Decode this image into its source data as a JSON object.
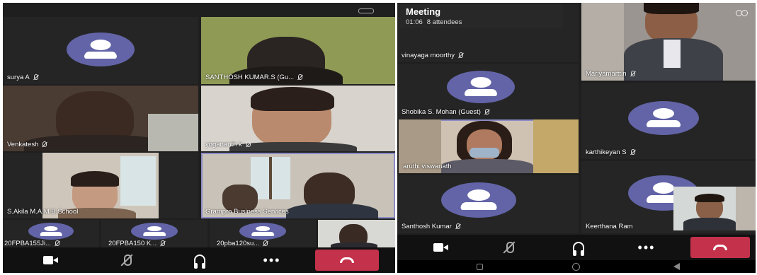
{
  "left_call": {
    "participants": [
      {
        "name": "surya A",
        "muted": true,
        "video": false
      },
      {
        "name": "SANTHOSH KUMAR.S (Gu...",
        "muted": true,
        "video": true
      },
      {
        "name": "Venkatesh",
        "muted": true,
        "video": true
      },
      {
        "name": "yogananth k",
        "muted": true,
        "video": true
      },
      {
        "name": "S.Akila M.A.M.B.School",
        "muted": false,
        "video": true
      },
      {
        "name": "Grampro Business Services",
        "muted": false,
        "video": true
      },
      {
        "name": "20FPBA155Ji...",
        "muted": true,
        "video": false
      },
      {
        "name": "20FPBA150 K...",
        "muted": true,
        "video": false
      },
      {
        "name": "20pba120su...",
        "muted": true,
        "video": false
      }
    ]
  },
  "right_call": {
    "meeting_title": "Meeting",
    "duration": "01:06",
    "attendees": "8 attendees",
    "participants": [
      {
        "name": "vinayaga moorthy",
        "muted": true,
        "video": false
      },
      {
        "name": "Mariyamarttin",
        "muted": true,
        "video": true
      },
      {
        "name": "Shobika S. Mohan (Guest)",
        "muted": true,
        "video": false
      },
      {
        "name": "karthikeyan S",
        "muted": true,
        "video": false
      },
      {
        "name": "aruthi viswanath",
        "muted": false,
        "video": true
      },
      {
        "name": "Santhosh Kumar",
        "muted": true,
        "video": false
      },
      {
        "name": "Keerthana Ram",
        "muted": false,
        "video": false
      }
    ]
  },
  "icons": {
    "camera": "video-camera-icon",
    "mic": "microphone-off-icon",
    "audio": "headset-icon",
    "more": "more-options-icon",
    "hangup": "hang-up-icon",
    "participants": "participants-icon"
  },
  "controls": {
    "more_label": "•••"
  },
  "colors": {
    "avatar": "#6264a7",
    "hangup": "#c4314b",
    "background": "#1f1f1f",
    "selected_outline": "#8b8cc7"
  }
}
